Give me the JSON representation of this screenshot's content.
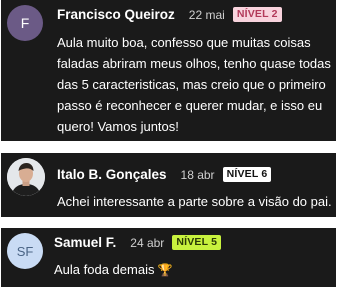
{
  "comments": [
    {
      "initials": "F",
      "author": "Francisco Queiroz",
      "date": "22 mai",
      "level": "NÍVEL 2",
      "level_color": "#f8d3dd",
      "text": "Aula muito boa, confesso que muitas coisas faladas abriram meus olhos, tenho quase todas das 5 caracteristicas, mas creio que o primeiro passo é reconhecer e querer mudar, e isso eu quero! Vamos juntos!"
    },
    {
      "avatar": "photo",
      "author": "Italo B. Gonçales",
      "date": "18 abr",
      "level": "NÍVEL 6",
      "level_color": "#ffffff",
      "text": "Achei interessante a parte sobre a visão do pai."
    },
    {
      "initials": "SF",
      "author": "Samuel F.",
      "date": "24 abr",
      "level": "NÍVEL 5",
      "level_color": "#c8f23e",
      "text": "Aula foda demais",
      "emoji": "trophy-icon"
    }
  ]
}
